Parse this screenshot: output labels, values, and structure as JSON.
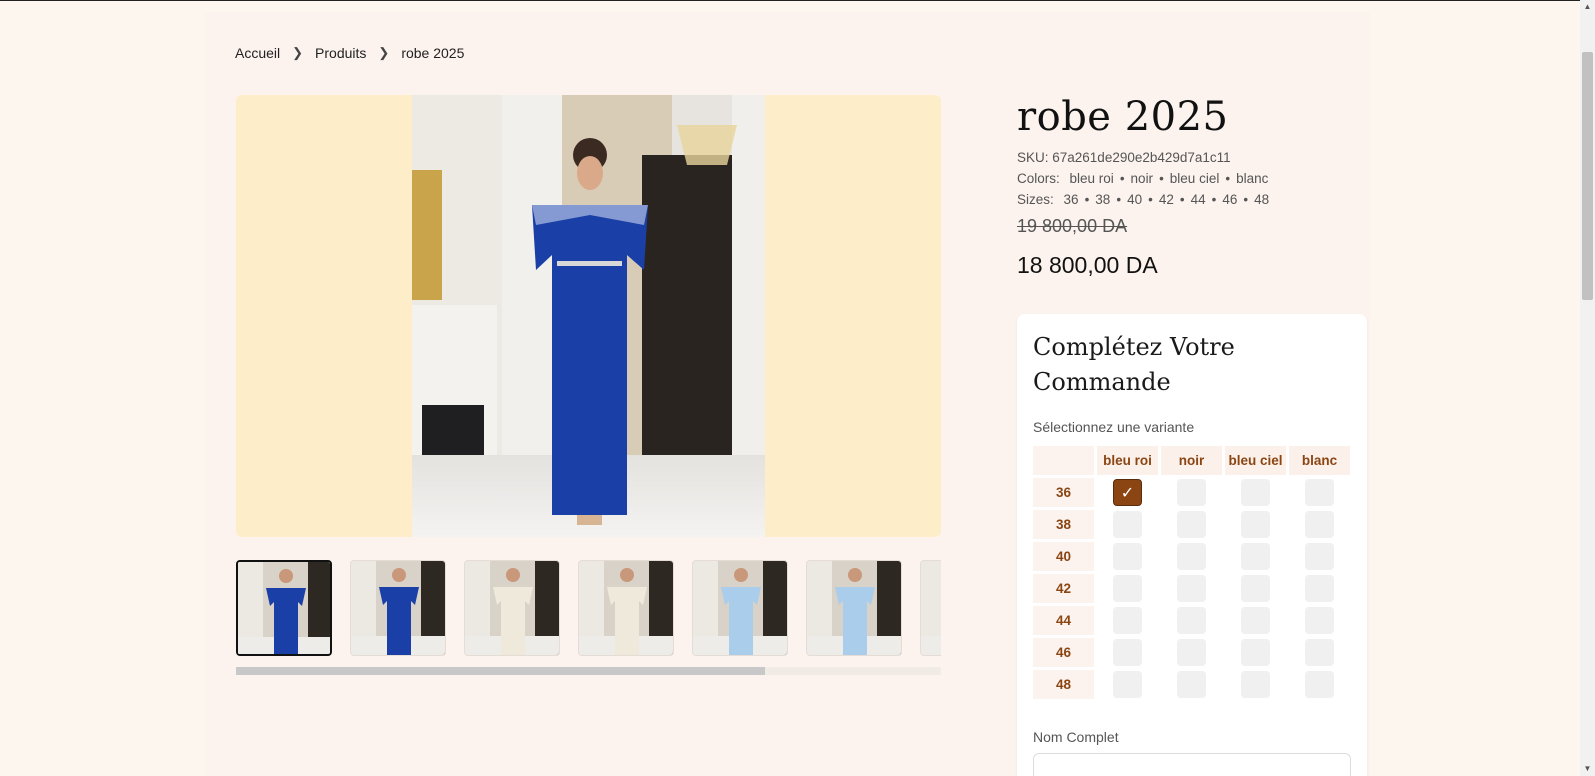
{
  "breadcrumb": {
    "home": "Accueil",
    "products": "Produits",
    "current": "robe 2025"
  },
  "product": {
    "title": "robe 2025",
    "sku": "SKU: 67a261de290e2b429d7a1c11",
    "colors_label": "Colors:",
    "colors": [
      "bleu roi",
      "noir",
      "bleu ciel",
      "blanc"
    ],
    "sizes_label": "Sizes:",
    "sizes": [
      "36",
      "38",
      "40",
      "42",
      "44",
      "46",
      "48"
    ],
    "old_price": "19 800,00 DA",
    "price": "18 800,00 DA"
  },
  "order": {
    "title": "Complétez Votre Commande",
    "variant_label": "Sélectionnez une variante",
    "columns": [
      "bleu roi",
      "noir",
      "bleu ciel",
      "blanc"
    ],
    "rows": [
      "36",
      "38",
      "40",
      "42",
      "44",
      "46",
      "48"
    ],
    "selected": {
      "size": "36",
      "color": "bleu roi"
    },
    "check_glyph": "✓",
    "name_label": "Nom Complet",
    "name_value": ""
  },
  "gallery": {
    "thumb_count": 7,
    "scroll_fraction": 0.75,
    "dress_colors": [
      "#1a3fa6",
      "#1a3fa6",
      "#efe9dc",
      "#efe9dc",
      "#a9cdea",
      "#a9cdea",
      "#1a3fa6"
    ]
  },
  "colors": {
    "accent": "#8b4513",
    "background": "#fdf6ef",
    "panel": "#fcf3ee",
    "image_bg": "#fdeec9"
  }
}
